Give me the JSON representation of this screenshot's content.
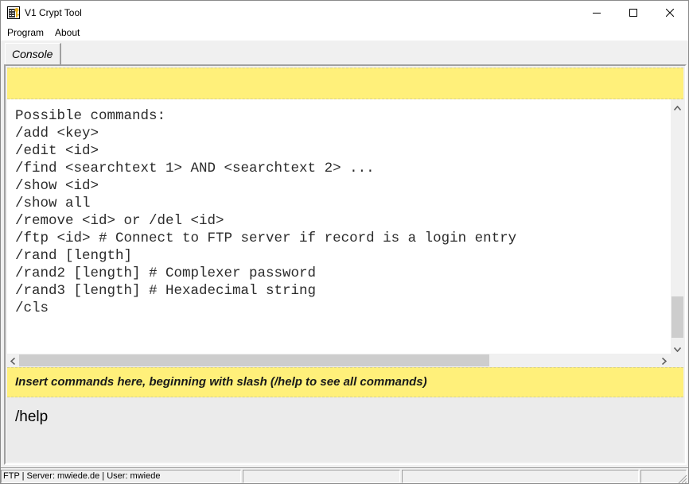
{
  "window": {
    "title": "V1 Crypt Tool",
    "icon": "key-database-icon",
    "controls": {
      "minimize": "minimize-icon",
      "maximize": "maximize-icon",
      "close": "close-icon"
    }
  },
  "menubar": {
    "items": [
      {
        "label": "Program"
      },
      {
        "label": "About"
      }
    ]
  },
  "tabs": [
    {
      "label": "Console",
      "active": true
    }
  ],
  "console": {
    "info_bar_text": "",
    "output_lines": [
      "Possible commands:",
      "/add <key>",
      "/edit <id>",
      "/find <searchtext 1> AND <searchtext 2> ...",
      "/show <id>",
      "/show all",
      "/remove <id> or /del <id>",
      "/ftp <id> # Connect to FTP server if record is a login entry",
      "/rand [length]",
      "/rand2 [length] # Complexer password",
      "/rand3 [length] # Hexadecimal string",
      "/cls"
    ],
    "hint": "Insert commands here, beginning with slash (/help to see all commands)",
    "input_value": "/help",
    "colors": {
      "yellow_bar": "#fff07a",
      "output_bg": "#ffffff",
      "input_bg": "#ebebeb"
    }
  },
  "statusbar": {
    "panels": [
      {
        "text": "FTP | Server: mwiede.de | User: mwiede"
      },
      {
        "text": ""
      },
      {
        "text": ""
      },
      {
        "text": ""
      }
    ]
  }
}
